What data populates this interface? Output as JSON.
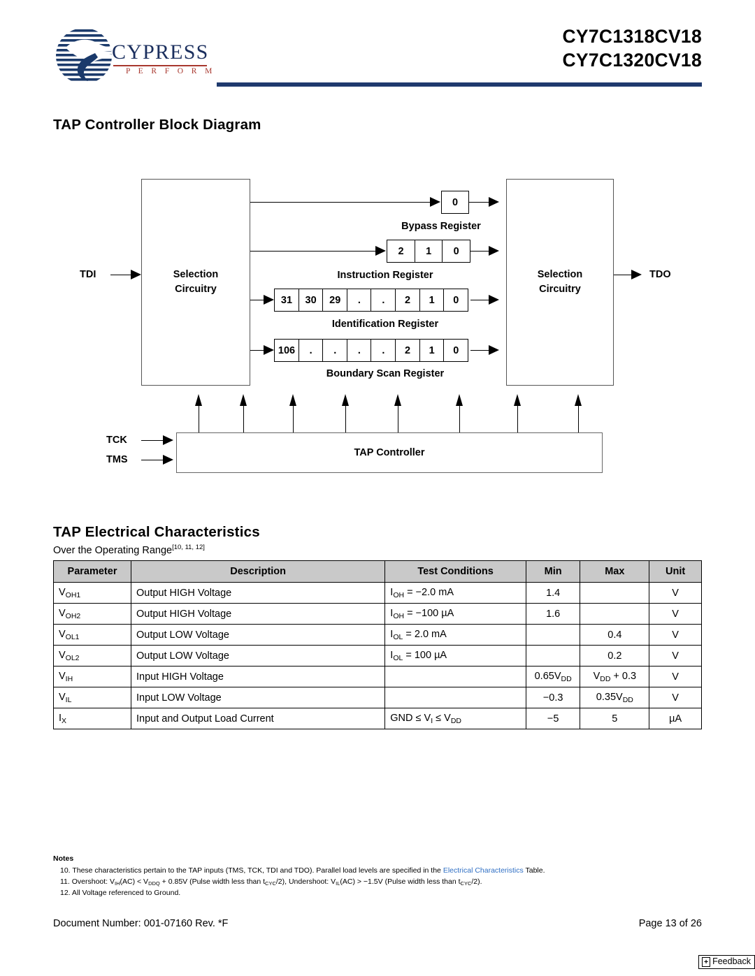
{
  "header": {
    "logo_word": "CYPRESS",
    "logo_tagline": "P E R F O R M",
    "part_number_1": "CY7C1318CV18",
    "part_number_2": "CY7C1320CV18",
    "rule_color": "#1f3a6e"
  },
  "sections": {
    "diagram_heading": "TAP Controller Block Diagram",
    "electrical_heading": "TAP Electrical Characteristics",
    "operating_range": "Over the Operating Range",
    "operating_range_refs": "[10, 11, 12]"
  },
  "diagram": {
    "input_tdi": "TDI",
    "input_tck": "TCK",
    "input_tms": "TMS",
    "output_tdo": "TDO",
    "selection_left_line1": "Selection",
    "selection_left_line2": "Circuitry",
    "selection_right_line1": "Selection",
    "selection_right_line2": "Circuitry",
    "tap_controller_label": "TAP Controller",
    "registers": [
      {
        "name": "bypass",
        "label": "Bypass Register",
        "cells": [
          "0"
        ]
      },
      {
        "name": "instruction",
        "label": "Instruction Register",
        "cells": [
          "2",
          "1",
          "0"
        ]
      },
      {
        "name": "identification",
        "label": "Identification Register",
        "cells": [
          "31",
          "30",
          "29",
          ".",
          ".",
          "2",
          "1",
          "0"
        ]
      },
      {
        "name": "boundary-scan",
        "label": "Boundary Scan Register",
        "cells": [
          "106",
          ".",
          ".",
          ".",
          ".",
          "2",
          "1",
          "0"
        ]
      }
    ]
  },
  "table": {
    "columns": [
      "Parameter",
      "Description",
      "Test Conditions",
      "Min",
      "Max",
      "Unit"
    ],
    "rows": [
      {
        "param_base": "V",
        "param_sub": "OH1",
        "description": "Output HIGH Voltage",
        "test_base": "I",
        "test_sub": "OH",
        "test_tail": " = −2.0 mA",
        "min": "1.4",
        "max": "",
        "unit": "V"
      },
      {
        "param_base": "V",
        "param_sub": "OH2",
        "description": "Output HIGH Voltage",
        "test_base": "I",
        "test_sub": "OH",
        "test_tail": " = −100 µA",
        "min": "1.6",
        "max": "",
        "unit": "V"
      },
      {
        "param_base": "V",
        "param_sub": "OL1",
        "description": "Output LOW Voltage",
        "test_base": "I",
        "test_sub": "OL",
        "test_tail": " = 2.0 mA",
        "min": "",
        "max": "0.4",
        "unit": "V"
      },
      {
        "param_base": "V",
        "param_sub": "OL2",
        "description": "Output LOW Voltage",
        "test_base": "I",
        "test_sub": "OL",
        "test_tail": " = 100 µA",
        "min": "",
        "max": "0.2",
        "unit": "V"
      },
      {
        "param_base": "V",
        "param_sub": "IH",
        "description": "Input HIGH Voltage",
        "test_base": "",
        "test_sub": "",
        "test_tail": "",
        "min_base": "0.65V",
        "min_sub": "DD",
        "max_base": "V",
        "max_sub": "DD",
        "max_tail": " + 0.3",
        "unit": "V"
      },
      {
        "param_base": "V",
        "param_sub": "IL",
        "description": "Input LOW Voltage",
        "test_base": "",
        "test_sub": "",
        "test_tail": "",
        "min": "−0.3",
        "max_base": "0.35V",
        "max_sub": "DD",
        "max_tail": "",
        "unit": "V"
      },
      {
        "param_base": "I",
        "param_sub": "X",
        "description": "Input and Output Load Current",
        "test_raw_pre": "GND ≤ V",
        "test_raw_sub": "I",
        "test_raw_mid": " ≤ V",
        "test_raw_sub2": "DD",
        "min": "−5",
        "max": "5",
        "unit": "µA"
      }
    ]
  },
  "notes": {
    "title": "Notes",
    "note10_pre": "10. These characteristics pertain to the TAP inputs (TMS, TCK, TDI and TDO). Parallel load levels are specified in the ",
    "note10_link": "Electrical Characteristics",
    "note10_post": " Table.",
    "note11_p1": "11. Overshoot: V",
    "note11_s1": "IH",
    "note11_p2": "(AC) < V",
    "note11_s2": "DDQ",
    "note11_p3": " + 0.85V (Pulse width less than t",
    "note11_s3": "CYC",
    "note11_p4": "/2), Undershoot: V",
    "note11_s4": "IL",
    "note11_p5": "(AC) > −1.5V (Pulse width less than t",
    "note11_s5": "CYC",
    "note11_p6": "/2).",
    "note12": "12. All Voltage referenced to Ground."
  },
  "footer": {
    "document_number": "Document Number: 001-07160 Rev. *F",
    "page_number": "Page 13 of 26",
    "feedback_plus": "+",
    "feedback_label": "Feedback"
  }
}
